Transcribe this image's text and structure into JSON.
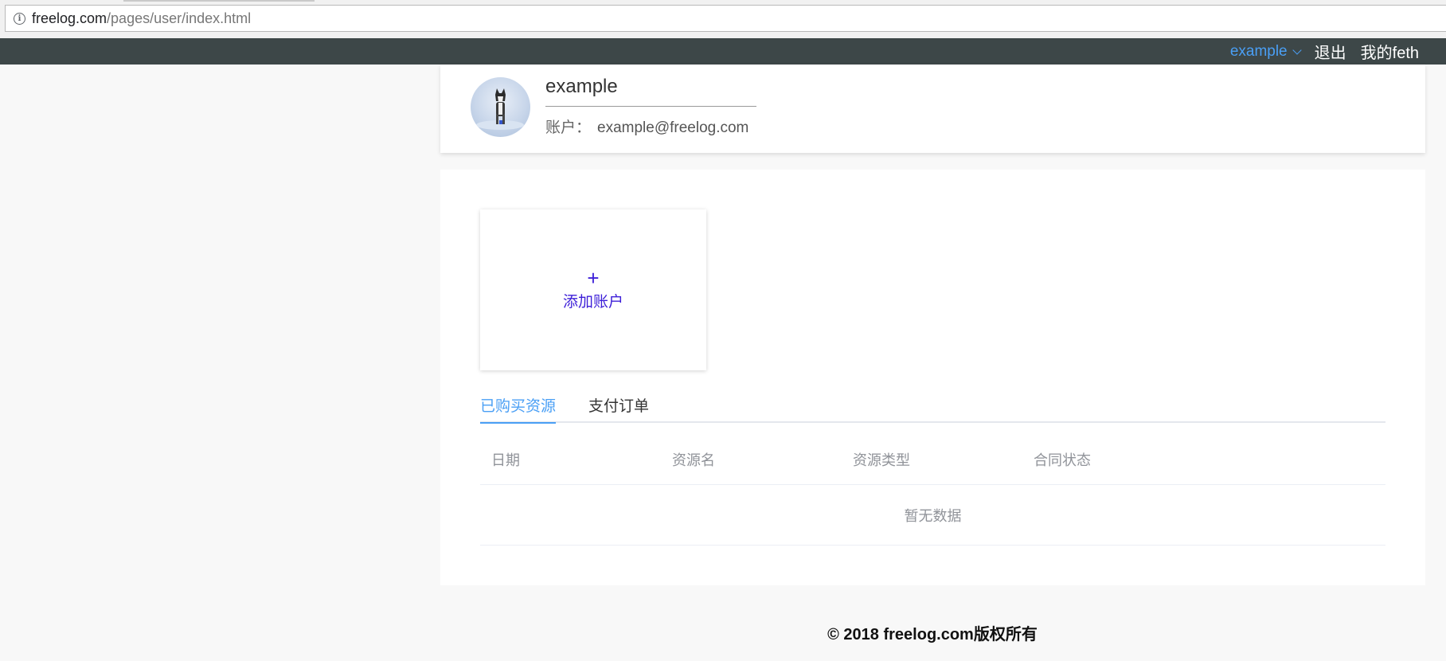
{
  "browser": {
    "url_domain": "freelog.com",
    "url_path": "/pages/user/index.html",
    "info_icon": "info-icon"
  },
  "nav": {
    "user_label": "example",
    "logout_label": "退出",
    "my_feth_label": "我的feth"
  },
  "profile": {
    "username": "example",
    "account_label": "账户：",
    "email": "example@freelog.com"
  },
  "add_account": {
    "icon": "plus-icon",
    "label": "添加账户"
  },
  "tabs": [
    {
      "label": "已购买资源",
      "active": true
    },
    {
      "label": "支付订单",
      "active": false
    }
  ],
  "table": {
    "columns": [
      "日期",
      "资源名",
      "资源类型",
      "合同状态"
    ],
    "empty_text": "暂无数据"
  },
  "footer": {
    "text": "© 2018 freelog.com版权所有"
  },
  "colors": {
    "nav_bg": "#3d4748",
    "accent": "#4a9ff5",
    "add_account": "#3d1fd8"
  }
}
